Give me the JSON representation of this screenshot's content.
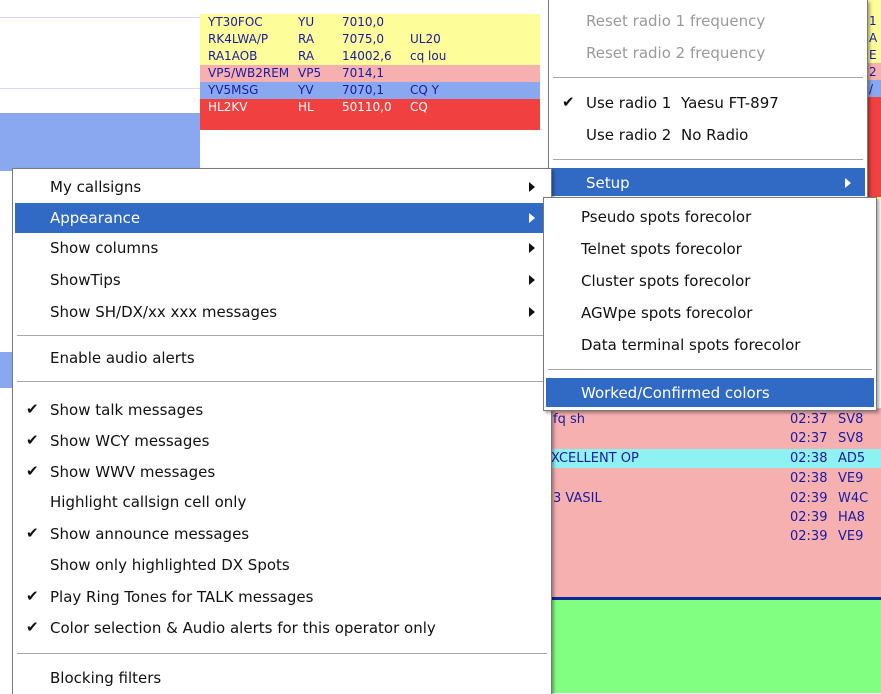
{
  "spots": [
    {
      "call": "YT30FOC",
      "pfx": "YU",
      "freq": "7010,0",
      "comment": "",
      "bg": "#fdfd9a"
    },
    {
      "call": "RK4LWA/P",
      "pfx": "RA",
      "freq": "7075,0",
      "comment": "UL20",
      "bg": "#fdfd9a"
    },
    {
      "call": "RA1AOB",
      "pfx": "RA",
      "freq": "14002,6",
      "comment": "cq lou",
      "bg": "#fdfd9a"
    },
    {
      "call": "VP5/WB2REM",
      "pfx": "VP5",
      "freq": "7014,1",
      "comment": "",
      "bg": "#f7b0b0"
    },
    {
      "call": "YV5MSG",
      "pfx": "YV",
      "freq": "7070,1",
      "comment": "CQ Y",
      "bg": "#8aa8f0"
    },
    {
      "call": "HL2KV",
      "pfx": "HL",
      "freq": "50110,0",
      "comment": "CQ",
      "bg": "#f04040"
    }
  ],
  "lower_spots": [
    {
      "comment": "fq sh",
      "time": "02:37",
      "call": "SV8",
      "bg": "#f7b0b0"
    },
    {
      "comment": "",
      "time": "02:37",
      "call": "SV8",
      "bg": "#f7b0b0"
    },
    {
      "comment": "XCELLENT OP",
      "time": "02:38",
      "call": "AD5",
      "bg": "#8ff2f2"
    },
    {
      "comment": "",
      "time": "02:38",
      "call": "VE9",
      "bg": "#f7b0b0"
    },
    {
      "comment": "3 VASIL",
      "time": "02:39",
      "call": "W4C",
      "bg": "#f7b0b0"
    },
    {
      "comment": "",
      "time": "02:39",
      "call": "HA8",
      "bg": "#f7b0b0"
    },
    {
      "comment": "",
      "time": "02:39",
      "call": "VE9",
      "bg": "#f7b0b0"
    }
  ],
  "colors": {
    "green_area": "#80ff80",
    "highlight": "#316ac5",
    "navy": "#0a2a9a"
  },
  "main_menu": {
    "my_callsigns": "My callsigns",
    "appearance": "Appearance",
    "show_columns": "Show columns",
    "show_tips": "ShowTips",
    "show_sh_dx": "Show SH/DX/xx xxx messages",
    "enable_audio": "Enable audio alerts",
    "show_talk": "Show talk messages",
    "show_wcy": "Show WCY messages",
    "show_wwv": "Show WWV messages",
    "highlight_cell": "Highlight callsign cell only",
    "show_announce": "Show announce messages",
    "show_highlighted": "Show only highlighted DX Spots",
    "play_ring": "Play Ring Tones for TALK messages",
    "color_selection": "Color selection & Audio alerts for this operator only",
    "blocking_filters": "Blocking filters",
    "check_glyph": "✔"
  },
  "radio_menu": {
    "reset_radio1": "Reset radio 1 frequency",
    "reset_radio2": "Reset radio 2 frequency",
    "use_radio1": "Use radio 1",
    "radio1_name": "Yaesu FT-897",
    "use_radio2": "Use radio 2",
    "radio2_name": "No Radio",
    "setup": "Setup"
  },
  "appearance_menu": {
    "pseudo": "Pseudo spots forecolor",
    "telnet": "Telnet spots forecolor",
    "cluster": "Cluster spots forecolor",
    "agwpe": "AGWpe spots forecolor",
    "data_terminal": "Data terminal spots forecolor",
    "worked_confirmed": "Worked/Confirmed colors"
  },
  "right_edge_chars": [
    "1",
    "A",
    "E",
    "2",
    "/",
    ""
  ]
}
